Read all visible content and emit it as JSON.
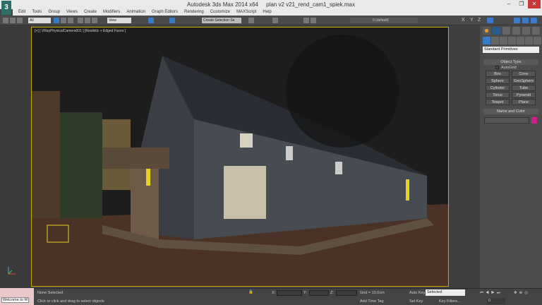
{
  "titlebar": {
    "app": "Autodesk 3ds Max  2014 x64",
    "file": "plan v2 v21_rend_cam1_spiek.max",
    "minimize": "–",
    "restore": "❐",
    "close": "✕"
  },
  "menu": [
    "Edit",
    "Tools",
    "Group",
    "Views",
    "Create",
    "Modifiers",
    "Animation",
    "Graph Editors",
    "Rendering",
    "Customize",
    "MAXScript",
    "Help"
  ],
  "toolbar": {
    "filter": "All",
    "ref_coord": "View",
    "selection_set": "Create Selection Se",
    "layer": "0 (default)",
    "axes": [
      "X",
      "Y",
      "Z"
    ]
  },
  "viewport": {
    "label": "[+] [ VRayPhysicalCamera001 ] [Realistic + Edged Faces ]"
  },
  "command_panel": {
    "dropdown": "Standard Primitives",
    "object_type": "Object Type",
    "autogrid": "AutoGrid",
    "buttons": [
      "Box",
      "Cone",
      "Sphere",
      "GeoSphere",
      "Cylinder",
      "Tube",
      "Torus",
      "Pyramid",
      "Teapot",
      "Plane"
    ],
    "name_and_color": "Name and Color",
    "color": "#d0208a"
  },
  "status": {
    "welcome": "Welcome to M",
    "selection": "None Selected",
    "prompt": "Click or click and drag to select objects",
    "x_label": "X:",
    "y_label": "Y:",
    "z_label": "Z:",
    "grid": "Grid = 10,0cm",
    "add_time_tag": "Add Time Tag",
    "auto_key": "Auto Key",
    "set_key": "Set Key",
    "key_mode": "Selected",
    "key_filters": "Key Filters...",
    "frame": "0"
  }
}
